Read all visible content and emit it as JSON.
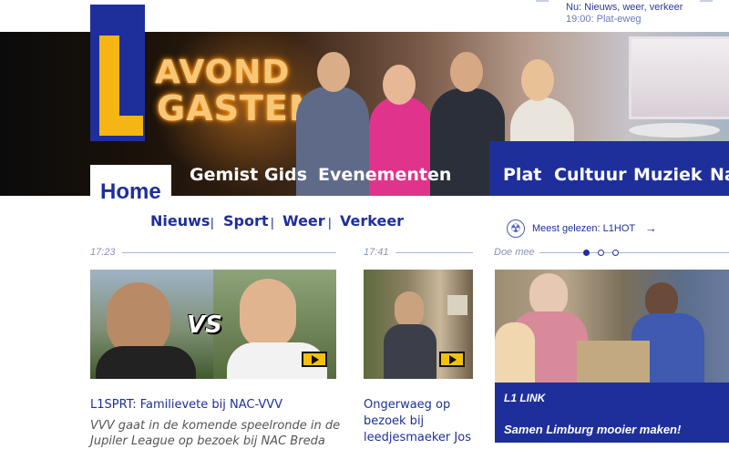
{
  "topbar": {
    "now": "Nu: Nieuws, weer, verkeer",
    "next": "19:00: Plat-eweg"
  },
  "hero": {
    "title_line1": "AVOND",
    "title_line2": "GASTEN"
  },
  "nav": {
    "home": "Home",
    "items": [
      "Gemist",
      "Gids",
      "Evenementen"
    ],
    "blue_items": [
      "Plat",
      "Cultuur",
      "Muziek",
      "Na"
    ]
  },
  "subnav": {
    "items": [
      "Nieuws",
      "Sport",
      "Weer",
      "Verkeer"
    ],
    "separator": "|"
  },
  "most_read": {
    "label": "Meest gelezen: L1HOT",
    "arrow": "→"
  },
  "timeline": {
    "col1_time": "17:23",
    "col2_time": "17:41",
    "doe_mee": "Doe mee",
    "active_dot": 0
  },
  "cards": [
    {
      "vs_text": "VS",
      "headline": "L1SPRT: Familievete bij NAC-VVV",
      "summary_1": "VVV gaat in de komende speelronde in de",
      "summary_2": "Jupiler League op bezoek bij NAC Breda"
    },
    {
      "headline_1": "Ongerwaeg op",
      "headline_2": "bezoek bij",
      "headline_3": "leedjesmaeker Jos"
    }
  ],
  "link_box": {
    "title": "L1 LINK",
    "subtitle": "Samen Limburg mooier maken!"
  },
  "colors": {
    "brand_blue": "#1e2f9c",
    "brand_yellow": "#f5b513"
  }
}
